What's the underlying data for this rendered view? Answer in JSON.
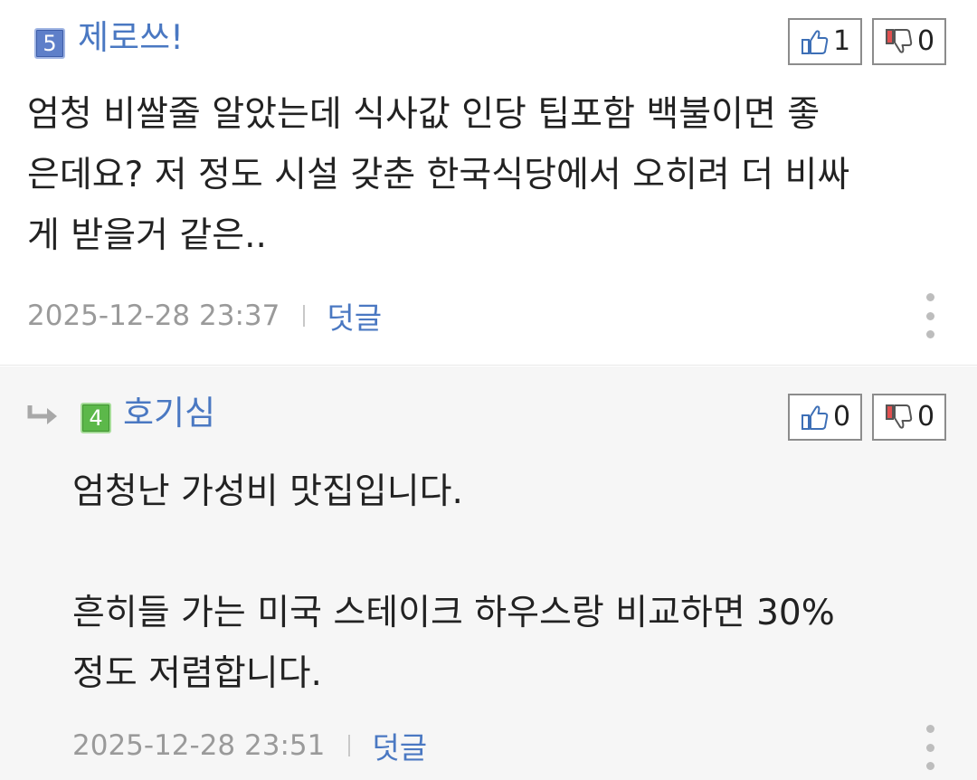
{
  "comments": [
    {
      "level": "5",
      "nickname": "제로쓰!",
      "likes": "1",
      "dislikes": "0",
      "body": "엄청 비쌀줄 알았는데 식사값 인당 팁포함 백불이면 좋\n은데요? 저 정도 시설 갖춘 한국식당에서 오히려 더 비싸\n게 받을거 같은..",
      "date": "2025-12-28 23:37",
      "reply_label": "덧글"
    },
    {
      "level": "4",
      "nickname": "호기심",
      "likes": "0",
      "dislikes": "0",
      "body": "엄청난 가성비 맛집입니다.\n\n흔히들 가는 미국 스테이크 하우스랑 비교하면 30%\n정도 저렴합니다.",
      "date": "2025-12-28 23:51",
      "reply_label": "덧글"
    }
  ],
  "icons": {
    "like": "thumbs-up-icon",
    "dislike": "thumbs-down-icon",
    "more": "more-vertical-icon",
    "reply_arrow": "reply-arrow-icon"
  },
  "colors": {
    "nickname": "#4a78c2",
    "level_5": "#5e7fc9",
    "level_4": "#5cb84a",
    "dislike_accent": "#e05050",
    "reply_background": "#f6f6f6"
  }
}
